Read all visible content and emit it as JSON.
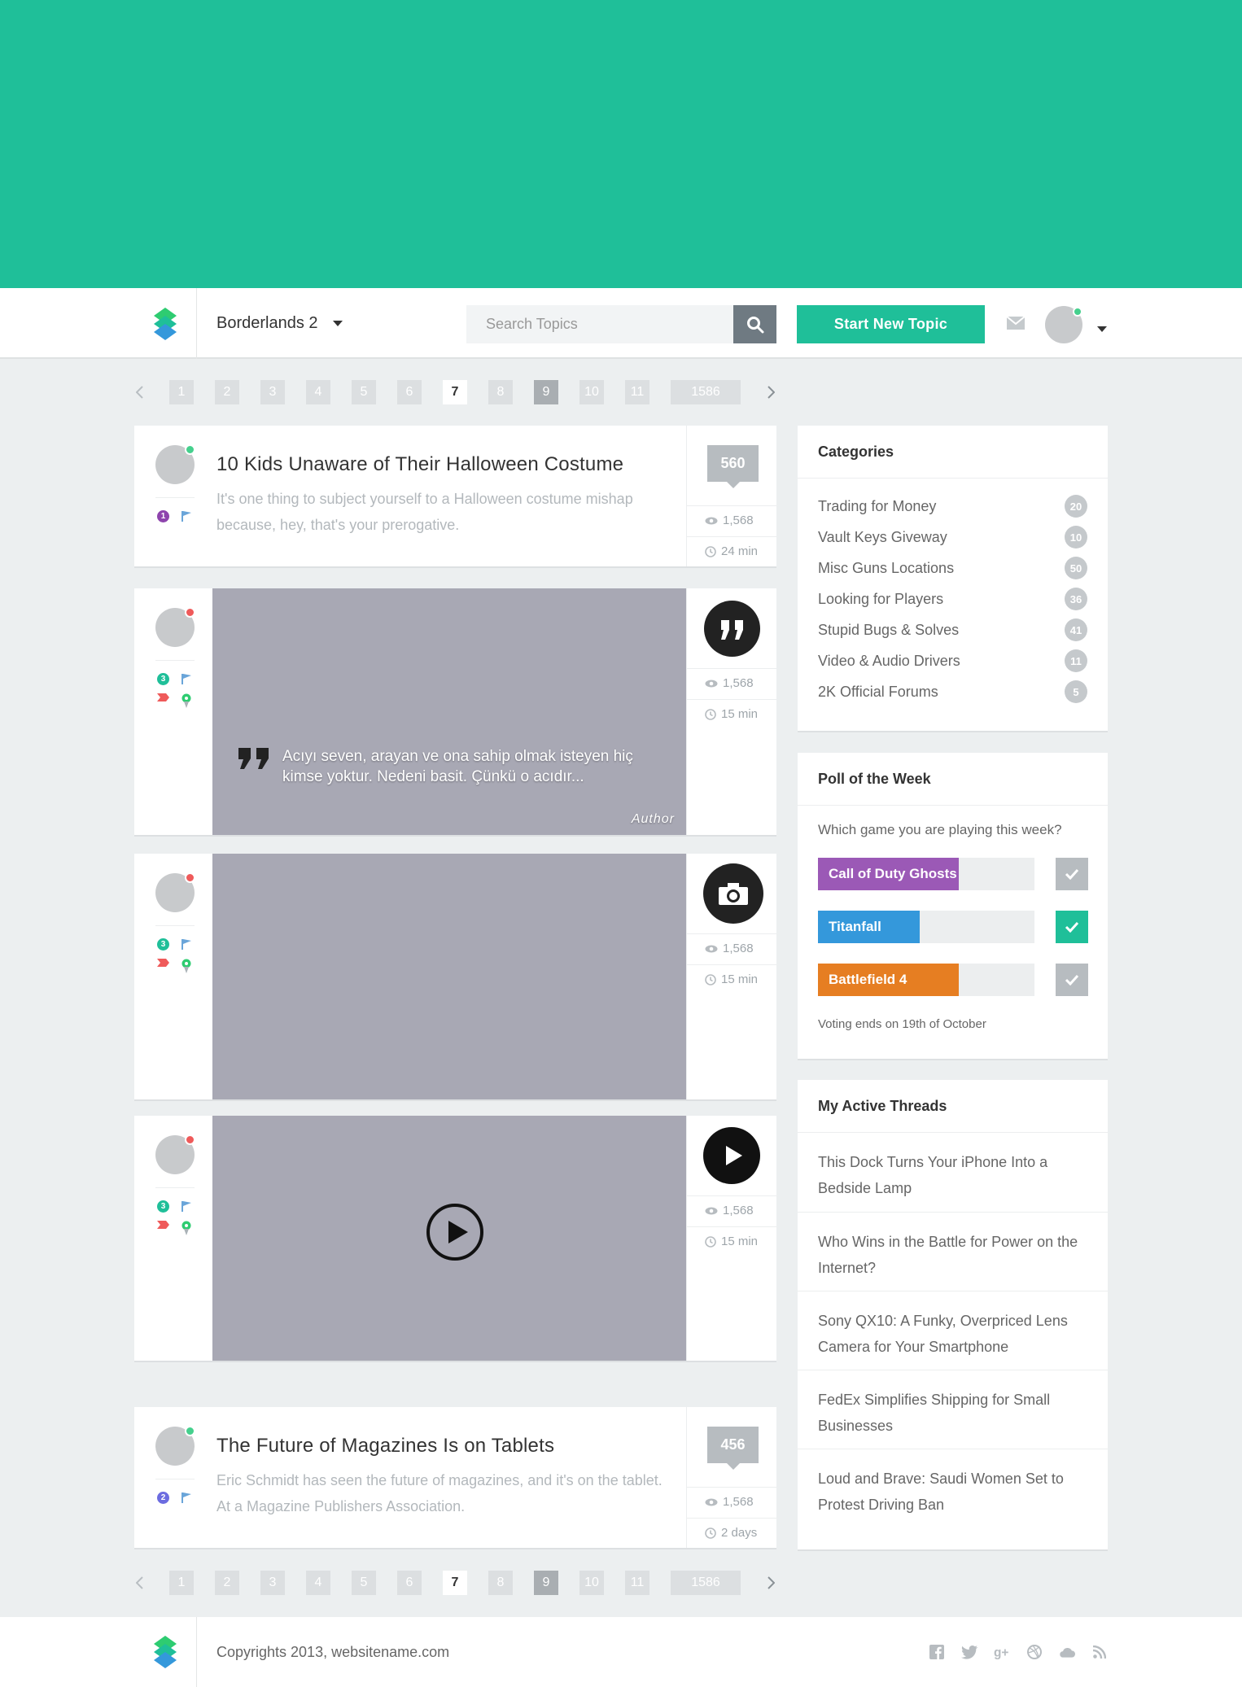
{
  "header": {
    "forum_name": "Borderlands 2",
    "search_placeholder": "Search Topics",
    "new_topic_label": "Start New Topic"
  },
  "pagination": {
    "pages": [
      "1",
      "2",
      "3",
      "4",
      "5",
      "6",
      "7",
      "8",
      "9",
      "10",
      "11",
      "1586"
    ],
    "active": "7"
  },
  "posts": [
    {
      "type": "text",
      "title": "10 Kids Unaware of Their Halloween Costume",
      "excerpt": "It's one thing to subject yourself to a Halloween costume mishap because, hey, that's your prerogative.",
      "replies": "560",
      "views": "1,568",
      "time": "24 min",
      "badge": "1"
    },
    {
      "type": "quote",
      "quote": "Acıyı seven, arayan ve ona sahip olmak isteyen hiç kimse yoktur. Nedeni basit. Çünkü o acıdır...",
      "author": "Author",
      "views": "1,568",
      "time": "15 min",
      "badge": "3"
    },
    {
      "type": "photo",
      "views": "1,568",
      "time": "15 min",
      "badge": "3"
    },
    {
      "type": "video",
      "views": "1,568",
      "time": "15 min",
      "badge": "3"
    },
    {
      "type": "text",
      "title": "The Future of Magazines Is on Tablets",
      "excerpt": "Eric Schmidt has seen the future of magazines, and it's on the tablet. At a Magazine Publishers Association.",
      "replies": "456",
      "views": "1,568",
      "time": "2 days",
      "badge": "2"
    }
  ],
  "categories": {
    "title": "Categories",
    "items": [
      {
        "label": "Trading for Money",
        "count": "20"
      },
      {
        "label": "Vault Keys Giveway",
        "count": "10"
      },
      {
        "label": "Misc Guns Locations",
        "count": "50"
      },
      {
        "label": "Looking for Players",
        "count": "36"
      },
      {
        "label": "Stupid Bugs & Solves",
        "count": "41"
      },
      {
        "label": "Video & Audio Drivers",
        "count": "11"
      },
      {
        "label": "2K Official Forums",
        "count": "5"
      }
    ]
  },
  "poll": {
    "title": "Poll of the Week",
    "question": "Which game you are playing this week?",
    "options": [
      {
        "label": "Call of Duty Ghosts",
        "fraction": 0.65,
        "color": "#9b59b6",
        "selected": false
      },
      {
        "label": "Titanfall",
        "fraction": 0.47,
        "color": "#3498db",
        "selected": true
      },
      {
        "label": "Battlefield 4",
        "fraction": 0.65,
        "color": "#e67e22",
        "selected": false
      }
    ],
    "end_note": "Voting ends on 19th of October"
  },
  "threads": {
    "title": "My Active Threads",
    "items": [
      "This Dock Turns Your iPhone Into a Bedside Lamp",
      "Who Wins in the Battle for Power on the Internet?",
      "Sony QX10: A Funky, Overpriced Lens Camera for Your Smartphone",
      "FedEx Simplifies Shipping for Small Businesses",
      "Loud and Brave: Saudi Women Set to Protest Driving Ban"
    ]
  },
  "footer": {
    "copyright": "Copyrights 2013, websitename.com",
    "socials": [
      "facebook-icon",
      "twitter-icon",
      "google-plus-icon",
      "dribbble-icon",
      "cloud-icon",
      "rss-icon"
    ]
  },
  "colors": {
    "brand": "#1fbf99",
    "online": "#45d08d",
    "offline": "#ef5a5a"
  }
}
